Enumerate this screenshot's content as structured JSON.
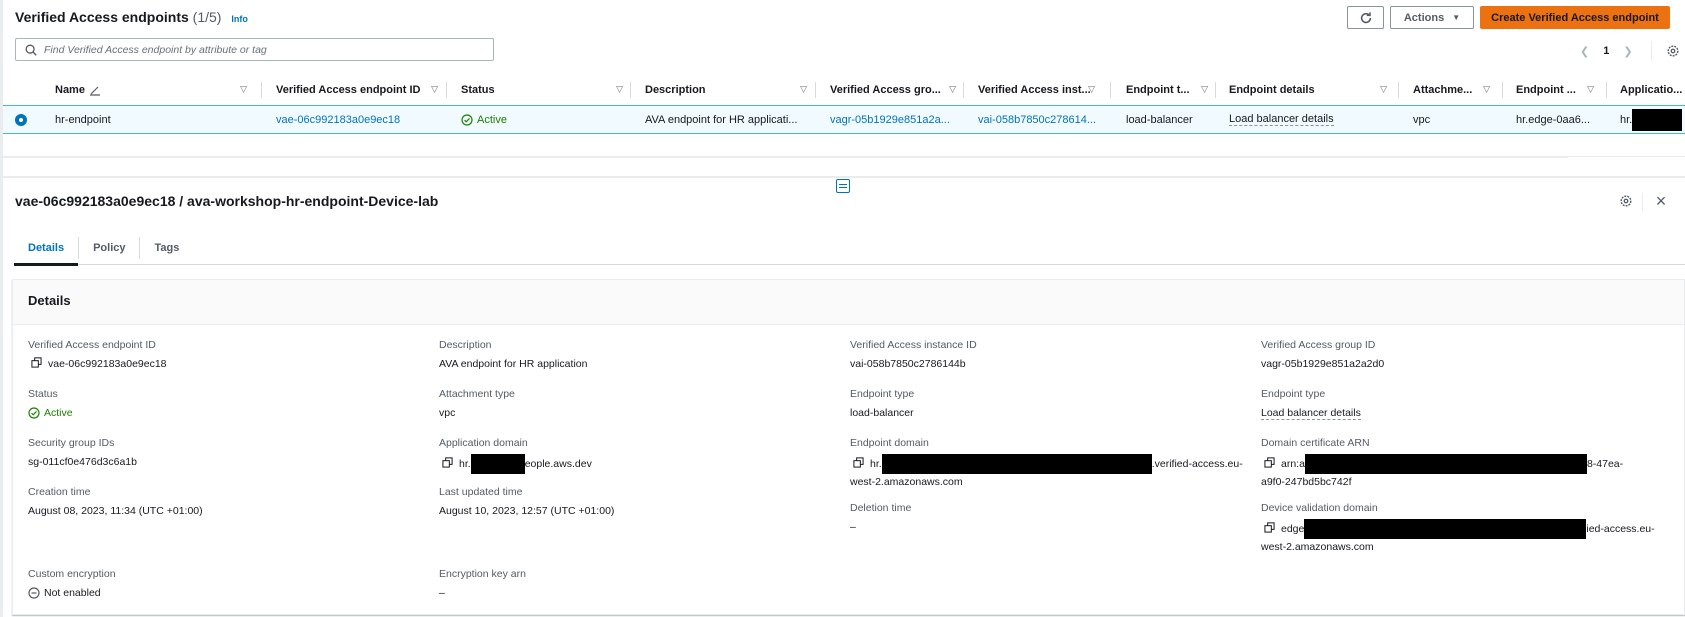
{
  "header": {
    "title": "Verified Access endpoints",
    "count": "(1/5)",
    "info": "Info",
    "actions_label": "Actions",
    "create_label": "Create Verified Access endpoint"
  },
  "search": {
    "placeholder": "Find Verified Access endpoint by attribute or tag"
  },
  "pagination": {
    "current_page": "1"
  },
  "table": {
    "columns": [
      "Name",
      "Verified Access endpoint ID",
      "Status",
      "Description",
      "Verified Access gro...",
      "Verified Access inst...",
      "Endpoint t...",
      "Endpoint details",
      "Attachme...",
      "Endpoint ...",
      "Applicatio..."
    ],
    "rows": [
      {
        "name": "hr-endpoint",
        "endpoint_id": "vae-06c992183a0e9ec18",
        "status": "Active",
        "description": "AVA endpoint for HR applicati...",
        "group": "vagr-05b1929e851a2a...",
        "instance": "vai-058b7850c278614...",
        "endpoint_type": "load-balancer",
        "endpoint_details": "Load balancer details",
        "attachment": "vpc",
        "endpoint_domain": "hr.edge-0aa6...",
        "application_prefix": "hr."
      }
    ]
  },
  "detail": {
    "title": "vae-06c992183a0e9ec18 / ava-workshop-hr-endpoint-Device-lab",
    "tabs": [
      "Details",
      "Policy",
      "Tags"
    ],
    "card_title": "Details",
    "fields": {
      "endpoint_id": {
        "label": "Verified Access endpoint ID",
        "value": "vae-06c992183a0e9ec18"
      },
      "status": {
        "label": "Status",
        "value": "Active"
      },
      "security_groups": {
        "label": "Security group IDs",
        "value": "sg-011cf0e476d3c6a1b"
      },
      "creation_time": {
        "label": "Creation time",
        "value": "August 08, 2023, 11:34 (UTC +01:00)"
      },
      "custom_encryption": {
        "label": "Custom encryption",
        "value": "Not enabled"
      },
      "description": {
        "label": "Description",
        "value": "AVA endpoint for HR application"
      },
      "attachment_type": {
        "label": "Attachment type",
        "value": "vpc"
      },
      "application_domain": {
        "label": "Application domain",
        "prefix": "hr.",
        "suffix": "eople.aws.dev"
      },
      "last_updated": {
        "label": "Last updated time",
        "value": "August 10, 2023, 12:57 (UTC +01:00)"
      },
      "encryption_key": {
        "label": "Encryption key arn",
        "value": "–"
      },
      "instance_id": {
        "label": "Verified Access instance ID",
        "value": "vai-058b7850c2786144b"
      },
      "endpoint_type": {
        "label": "Endpoint type",
        "value": "load-balancer"
      },
      "endpoint_domain": {
        "label": "Endpoint domain",
        "prefix": "hr.",
        "suffix": ".verified-access.eu-",
        "line2": "west-2.amazonaws.com"
      },
      "deletion_time": {
        "label": "Deletion time",
        "value": "–"
      },
      "group_id": {
        "label": "Verified Access group ID",
        "value": "vagr-05b1929e851a2a2d0"
      },
      "endpoint_type_details": {
        "label": "Endpoint type",
        "value": "Load balancer details"
      },
      "domain_cert": {
        "label": "Domain certificate ARN",
        "prefix": "arn:a",
        "suffix": "8-47ea-",
        "line2": "a9f0-247bd5bc742f"
      },
      "device_validation": {
        "label": "Device validation domain",
        "prefix": "edge",
        "suffix": "ied-access.eu-",
        "line2": "west-2.amazonaws.com"
      }
    }
  },
  "colors": {
    "accent": "#0073bb",
    "primary_button": "#ec7211",
    "success": "#1d8102",
    "selected_row": "#f1faff"
  }
}
